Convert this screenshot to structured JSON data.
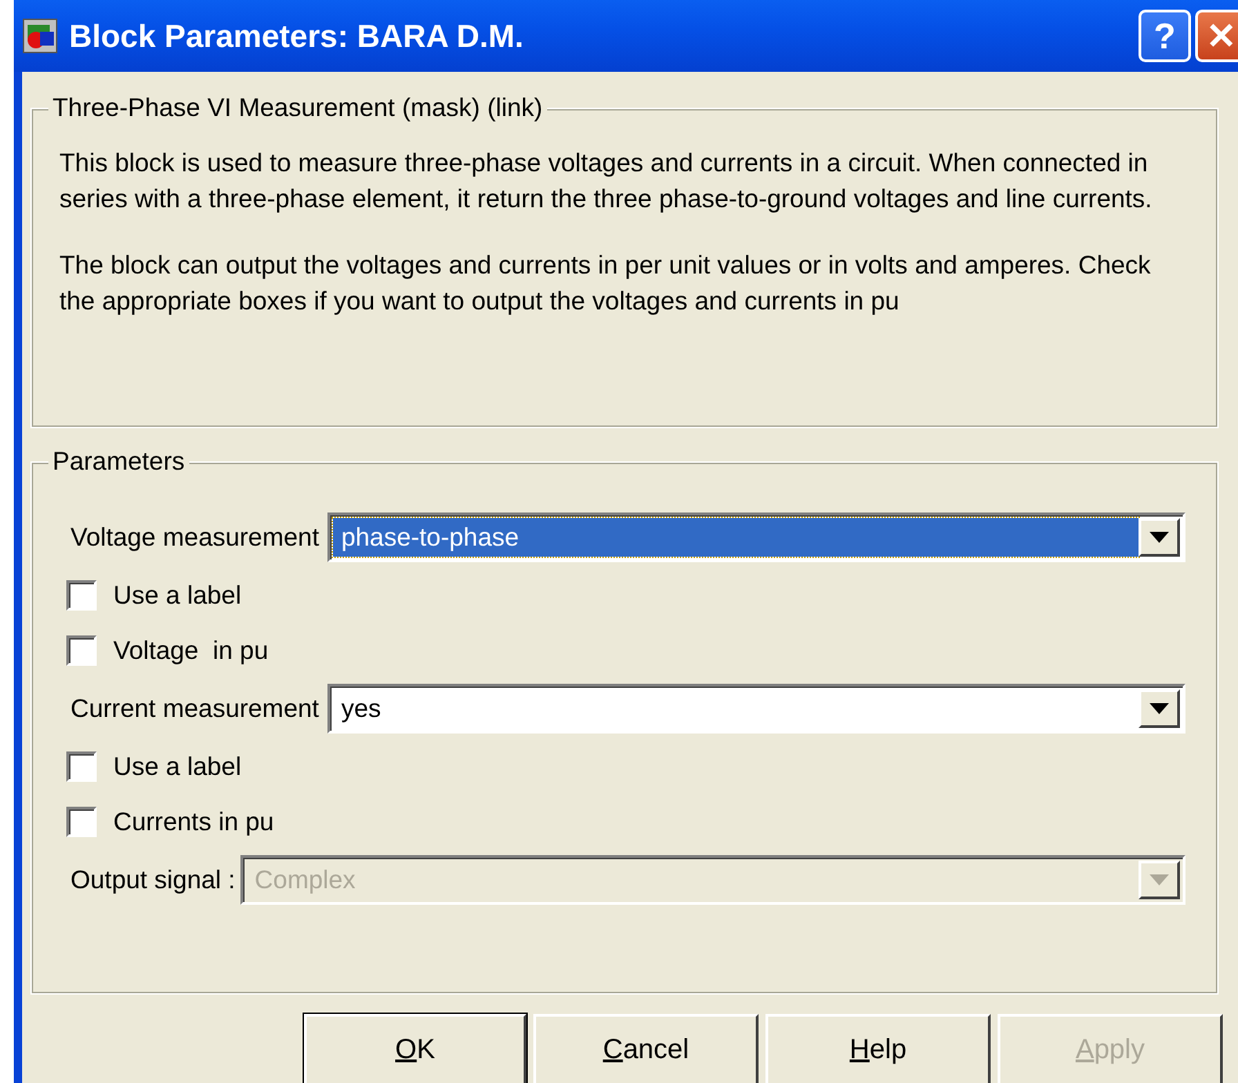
{
  "window": {
    "title": "Block Parameters: BARA D.M."
  },
  "title_buttons": [
    {
      "kind": "help",
      "label": "?"
    },
    {
      "kind": "close",
      "label": "✕"
    }
  ],
  "description": {
    "title": "Three-Phase VI Measurement (mask) (link)",
    "paragraphs": [
      "This block is used to measure three-phase voltages and currents in a circuit. When connected in series with a  three-phase element, it return the three phase-to-ground voltages and line currents.",
      "The block can output the voltages and currents in per unit values or in volts and amperes. Check the appropriate boxes if you want to output the voltages and currents in pu"
    ]
  },
  "parameters": {
    "title": "Parameters",
    "items": [
      {
        "kind": "select",
        "label": "Voltage measurement",
        "value": "phase-to-phase",
        "focused": true,
        "disabled": false
      },
      {
        "kind": "checkbox",
        "label": "Use a label",
        "checked": false
      },
      {
        "kind": "checkbox",
        "label": "Voltage  in pu",
        "checked": false
      },
      {
        "kind": "select",
        "label": "Current measurement",
        "value": "yes",
        "focused": false,
        "disabled": false
      },
      {
        "kind": "checkbox",
        "label": "Use a label",
        "checked": false
      },
      {
        "kind": "checkbox",
        "label": "Currents in pu",
        "checked": false
      },
      {
        "kind": "select",
        "label": "Output signal :",
        "value": "Complex",
        "focused": false,
        "disabled": true
      }
    ]
  },
  "buttons": [
    {
      "label": "OK",
      "default": true,
      "disabled": false
    },
    {
      "label": "Cancel",
      "default": false,
      "disabled": false
    },
    {
      "label": "Help",
      "default": false,
      "disabled": false
    },
    {
      "label": "Apply",
      "default": false,
      "disabled": true
    }
  ]
}
